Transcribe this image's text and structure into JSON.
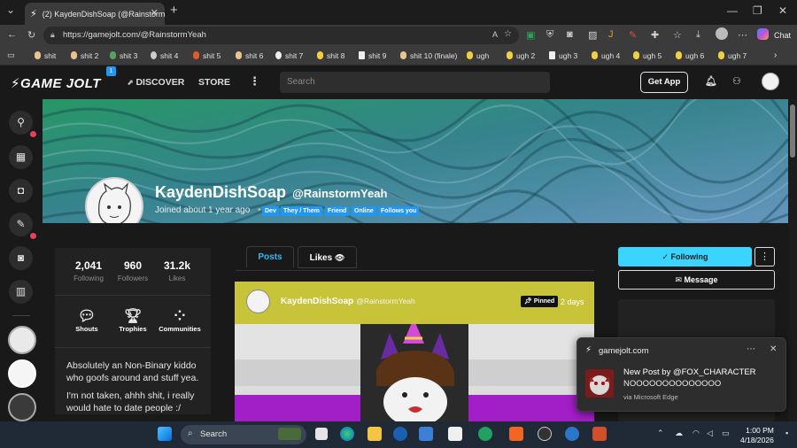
{
  "browser": {
    "tab_title": "(2) KaydenDishSoap (@RainstormYeah",
    "url": "https://gamejolt.com/@RainstormYeah",
    "chat_label": "Chat"
  },
  "bookmarks": [
    "shit",
    "shit 2",
    "shit 3",
    "shit 4",
    "shit 5",
    "shit 6",
    "shit 7",
    "shit 8",
    "shit 9",
    "shit 10 (finale)",
    "ugh",
    "ugh 2",
    "ugh 3",
    "ugh 4",
    "ugh 5",
    "ugh 6",
    "ugh 7"
  ],
  "gj": {
    "logo": "GAME JOLT",
    "notification_count": "1",
    "discover": "DISCOVER",
    "store": "STORE",
    "search_placeholder": "Search",
    "get_app": "Get App"
  },
  "profile": {
    "display_name": "KaydenDishSoap",
    "handle": "@RainstormYeah",
    "joined": "Joined about 1 year ago",
    "separator": "•",
    "tags": [
      "Dev",
      "They / Them",
      "Friend",
      "Online",
      "Follows you"
    ],
    "stats": [
      {
        "value": "2,041",
        "label": "Following"
      },
      {
        "value": "960",
        "label": "Followers"
      },
      {
        "value": "31.2k",
        "label": "Likes"
      }
    ],
    "quick_links": [
      "Shouts",
      "Trophies",
      "Communities"
    ],
    "bio_1": "Absolutely an Non-Binary kiddo who goofs around and stuff yea.",
    "bio_2": "I'm not taken, ahhh shit, i really would hate to date people :/"
  },
  "feed": {
    "tab_posts": "Posts",
    "tab_likes": "Likes",
    "post_author": "KaydenDishSoap",
    "post_handle": "@RainstormYeah",
    "pinned": "Pinned",
    "post_age": "2 days"
  },
  "actions": {
    "following": "Following",
    "more": "⋮",
    "message": "Message"
  },
  "toast": {
    "source": "gamejolt.com",
    "line1": "New Post by @FOX_CHARACTER",
    "line2": "NOOOOOOOOOOOOOO",
    "via": "via Microsoft Edge"
  },
  "taskbar": {
    "search": "Search",
    "time": "1:00 PM",
    "date": "4/18/2026"
  },
  "colors": {
    "accent_blue": "#2196f3",
    "following_cyan": "#3ad4ff",
    "notif_red": "#e3415c",
    "post_yellow": "#cfcf3a"
  }
}
